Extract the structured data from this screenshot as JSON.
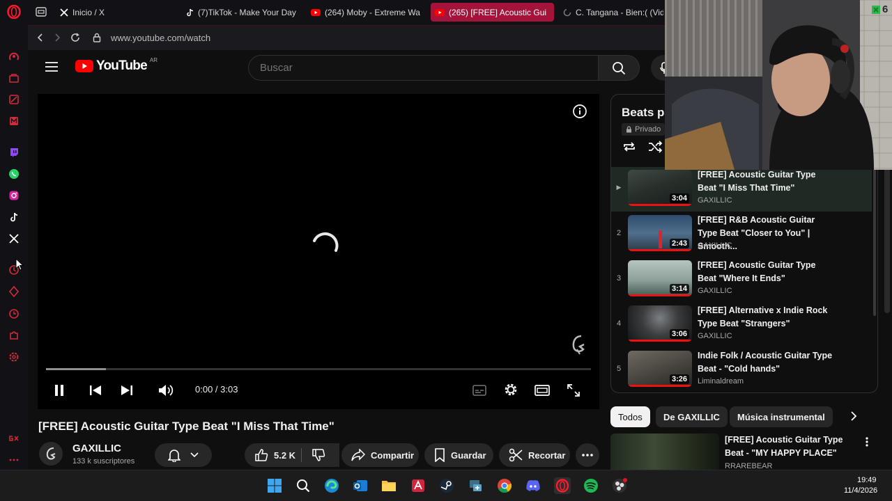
{
  "browser": {
    "tabs": [
      {
        "title": "Inicio / X",
        "icon": "x-logo-icon"
      },
      {
        "title": "(7)TikTok - Make Your Day",
        "icon": "tiktok-icon"
      },
      {
        "title": "(264) Moby - Extreme Wa",
        "icon": "youtube-icon"
      },
      {
        "title": "(265) [FREE] Acoustic Gui",
        "icon": "youtube-icon",
        "active": true
      },
      {
        "title": "C. Tangana - Bien:( (Vide",
        "icon": "loading-icon"
      }
    ],
    "url": "www.youtube.com/watch"
  },
  "youtube": {
    "logo_text": "YouTube",
    "region": "AR",
    "search_placeholder": "Buscar"
  },
  "player": {
    "time": "0:00 / 3:03",
    "progress_fraction": 0.0,
    "buffered_fraction": 0.11
  },
  "video": {
    "title": "[FREE] Acoustic Guitar Type Beat \"I Miss That Time\"",
    "channel": "GAXILLIC",
    "subscribers": "133 k suscriptores",
    "likes": "5.2 K",
    "share_label": "Compartir",
    "save_label": "Guardar",
    "clip_label": "Recortar"
  },
  "playlist": {
    "title": "Beats pa",
    "privacy": "Privado",
    "items": [
      {
        "index": "▶",
        "title": "[FREE] Acoustic Guitar Type Beat \"I Miss That Time\"",
        "channel": "GAXILLIC",
        "duration": "3:04",
        "watched_fraction": 1.0,
        "current": true
      },
      {
        "index": "2",
        "title": "[FREE] R&B Acoustic Guitar Type Beat \"Closer to You\" | Smooth...",
        "channel": "GAXILLIC",
        "duration": "2:43",
        "watched_fraction": 1.0
      },
      {
        "index": "3",
        "title": "[FREE] Acoustic Guitar Type Beat \"Where It Ends\"",
        "channel": "GAXILLIC",
        "duration": "3:14",
        "watched_fraction": 1.0
      },
      {
        "index": "4",
        "title": "[FREE] Alternative x Indie Rock Type Beat \"Strangers\"",
        "channel": "GAXILLIC",
        "duration": "3:06",
        "watched_fraction": 1.0
      },
      {
        "index": "5",
        "title": "Indie Folk / Acoustic Guitar Type Beat - \"Cold hands\"",
        "channel": "Liminaldream",
        "duration": "3:26",
        "watched_fraction": 1.0
      }
    ]
  },
  "chips": [
    "Todos",
    "De GAXILLIC",
    "Música instrumental"
  ],
  "recommendation": {
    "title": "[FREE] Acoustic Guitar Type Beat - \"MY HAPPY PLACE\"",
    "channel": "RRAREBEAR"
  },
  "overlay": {
    "badge": "6"
  },
  "taskbar": {
    "time": "19:49",
    "date": "11/4/2026"
  },
  "colors": {
    "accent_red": "#ff0000",
    "opera_red": "#a3133a",
    "youtube_bg": "#0f0f0f"
  }
}
